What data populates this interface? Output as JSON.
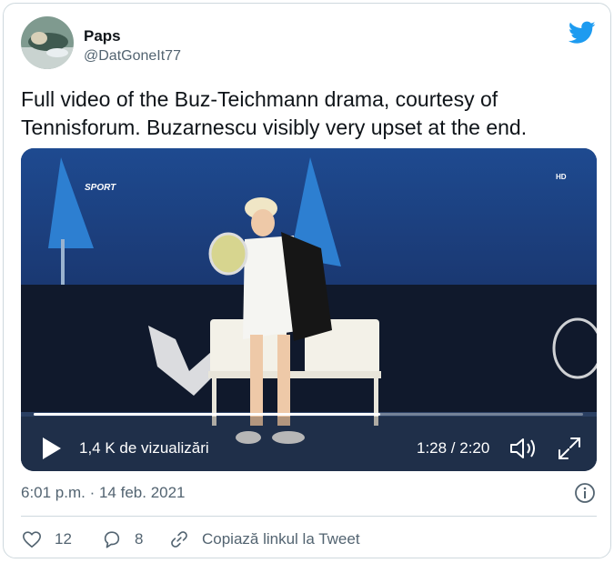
{
  "author": {
    "name": "Paps",
    "handle": "@DatGoneIt77"
  },
  "tweet": {
    "text": "Full video of the Buz-Teichmann drama, courtesy of Tennisforum. Buzarnescu visibly very upset at the end."
  },
  "video": {
    "views": "1,4 K de vizualizări",
    "time": "1:28 / 2:20",
    "progress": 0.63,
    "overlay_channel": "SPORT",
    "overlay_hd": "HD"
  },
  "meta": {
    "timestamp": "6:01 p.m. · 14 feb. 2021"
  },
  "actions": {
    "like_count": "12",
    "reply_count": "8",
    "copy_link_label": "Copiază linkul la Tweet"
  },
  "colors": {
    "twitter_blue": "#1d9bf0",
    "muted_text": "#536471",
    "border": "#cfd9de"
  },
  "icons": [
    "twitter-bird-icon",
    "play-icon",
    "volume-icon",
    "fullscreen-icon",
    "info-icon",
    "heart-icon",
    "reply-icon",
    "link-icon"
  ]
}
